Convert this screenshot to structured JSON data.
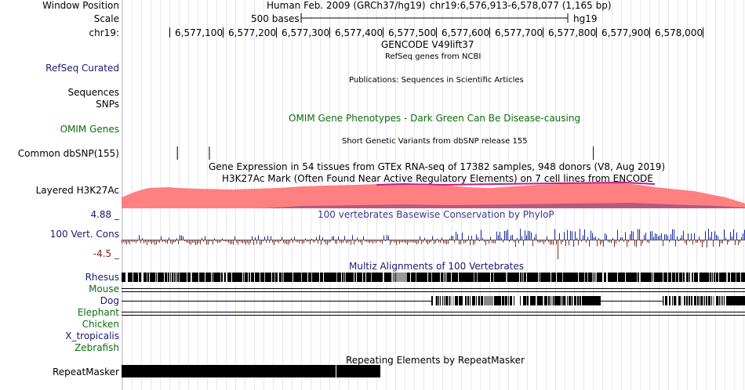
{
  "header": {
    "window_position_label": "Window Position",
    "assembly": "Human Feb. 2009 (GRCh37/hg19)",
    "position": "chr19:6,576,913-6,578,077 (1,165 bp)",
    "scale_label": "Scale",
    "scale_text": "500 bases",
    "scale_db": "hg19",
    "chrom_label": "chr19:",
    "ticks": [
      "6,577,100",
      "6,577,200",
      "6,577,300",
      "6,577,400",
      "6,577,500",
      "6,577,600",
      "6,577,700",
      "6,577,800",
      "6,577,900",
      "6,578,000"
    ]
  },
  "tracks": {
    "gencode_title": "GENCODE V49lift37",
    "refseq_subtitle": "RefSeq genes from NCBI",
    "refseq_label": "RefSeq Curated",
    "publications_title": "Publications: Sequences in Scientific Articles",
    "sequences_label": "Sequences",
    "snps_label": "SNPs",
    "omim_title": "OMIM Gene Phenotypes - Dark Green Can Be Disease-causing",
    "omim_label": "OMIM Genes",
    "dbsnp_title": "Short Genetic Variants from dbSNP release 155",
    "dbsnp_label": "Common dbSNP(155)",
    "gtex_title": "Gene Expression in 54 tissues from GTEx RNA-seq of 17382 samples, 948 donors (V8, Aug 2019)",
    "h3k27ac_title": "H3K27Ac Mark (Often Found Near Active Regulatory Elements) on 7 cell lines from ENCODE",
    "h3k27ac_label": "Layered H3K27Ac",
    "phylop_title": "100 vertebrates Basewise Conservation by PhyloP",
    "phylop_max": "4.88 _",
    "phylop_label": "100 Vert. Cons",
    "phylop_min": "-4.5 _",
    "multiz_title": "Multiz Alignments of 100 Vertebrates",
    "species": [
      "Rhesus",
      "Mouse",
      "Dog",
      "Elephant",
      "Chicken",
      "X_tropicalis",
      "Zebrafish"
    ],
    "repeat_title": "Repeating Elements by RepeatMasker",
    "repeat_label": "RepeatMasker"
  },
  "colors": {
    "grid": "#e6e6f3",
    "h3k27ac_fill": "#ff8080",
    "h3k27ac_top": "#c0208a",
    "phylop_pos": "#1a2aa0",
    "phylop_neg": "#8c2a1a",
    "label_navy": "#1a1a6e",
    "label_green": "#0a6e0a",
    "label_darkred": "#7a1e1e"
  },
  "dbsnp_marks_bp": [
    6577115,
    6577175,
    6577895
  ]
}
